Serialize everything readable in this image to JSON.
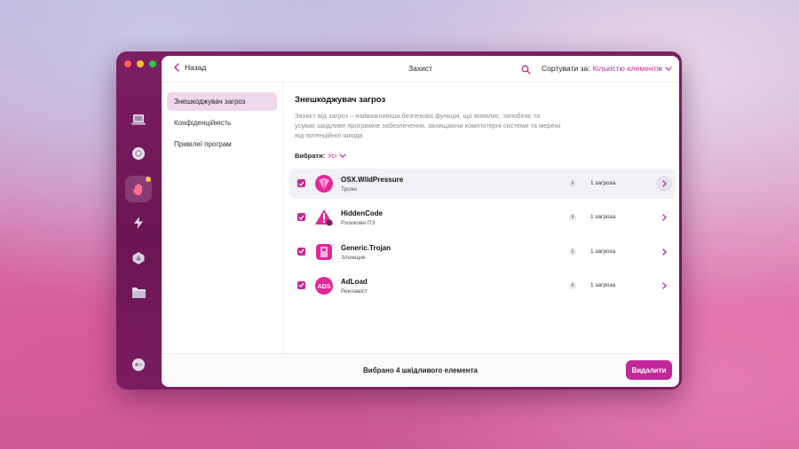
{
  "window": {
    "rail": {
      "items": [
        {
          "icon": "laptop-icon",
          "active": false
        },
        {
          "icon": "globe-icon",
          "active": false
        },
        {
          "icon": "hand-icon",
          "active": true,
          "badge": true
        },
        {
          "icon": "bolt-icon",
          "active": false
        },
        {
          "icon": "apps-icon",
          "active": false
        },
        {
          "icon": "folder-icon",
          "active": false
        },
        {
          "icon": "assistant-icon",
          "active": false
        }
      ]
    },
    "topbar": {
      "back_label": "Назад",
      "title": "Захист",
      "sort_label": "Сортувати за:",
      "sort_value": "Кількістю елементів"
    },
    "sidebar": {
      "items": [
        {
          "label": "Знешкоджувач загроз",
          "active": true
        },
        {
          "label": "Конфіденційність",
          "active": false
        },
        {
          "label": "Привілеї програм",
          "active": false
        }
      ]
    },
    "content": {
      "title": "Знешкоджувач загроз",
      "description": "Захист від загроз – найважливіша безпекова функція, що виявляє, запобігає та усуває шкідливе програмне забезпечення, захищаючи комп'ютерні системи та мережі від потенційної шкоди.",
      "filter_label": "Вибрати:",
      "filter_value": "Усі"
    },
    "threats": [
      {
        "name": "OSX.WildPressure",
        "type": "Троян",
        "count": "1 загроза",
        "icon": "trojan-icon",
        "checked": true
      },
      {
        "name": "HiddenCode",
        "type": "Ризикове ПЗ",
        "count": "1 загроза",
        "icon": "risky-software-icon",
        "checked": true
      },
      {
        "name": "Generic.Trojan",
        "type": "Зломщик",
        "count": "1 загроза",
        "icon": "hacker-tool-icon",
        "checked": true
      },
      {
        "name": "AdLoad",
        "type": "Рекламіст",
        "count": "1 загроза",
        "icon": "ads-icon",
        "icon_text": "ADS",
        "checked": true
      }
    ],
    "footer": {
      "status": "Вибрано 4 шкідливого елемента",
      "remove_label": "Видалити"
    },
    "colors": {
      "accent": "#c2289a",
      "sidebar_bg": "#6a1554",
      "badge": "#f3c34a"
    }
  }
}
